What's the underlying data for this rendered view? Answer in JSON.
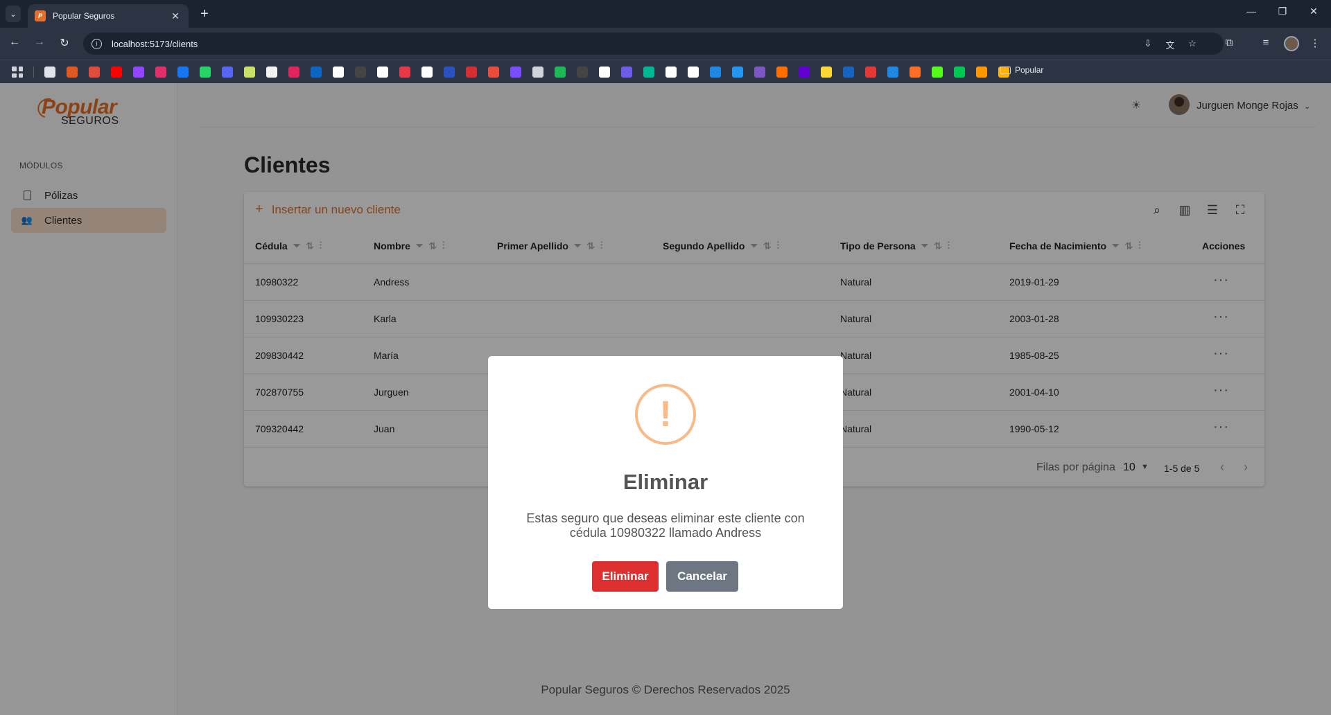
{
  "browser": {
    "tab_title": "Popular Seguros",
    "url": "localhost:5173/clients",
    "bookmark_folder": "Popular",
    "bookmark_colors": [
      "#dfe3ea",
      "#e25822",
      "#e24c3b",
      "#ff0000",
      "#9146ff",
      "#e1306c",
      "#1877f2",
      "#25d366",
      "#5865f2",
      "#c9e265",
      "#f2f2f2",
      "#e0245e",
      "#0a66c2",
      "#ffffff",
      "#444444",
      "#ffffff",
      "#e63946",
      "#ffffff",
      "#2a52be",
      "#d32f2f",
      "#e94e3a",
      "#7b4dff",
      "#cfd4dd",
      "#1db954",
      "#444444",
      "#ffffff",
      "#6c5ce7",
      "#00b894",
      "#ffffff",
      "#ffffff",
      "#1e88e5",
      "#2196f3",
      "#7e57c2",
      "#ff6f00",
      "#6001d2",
      "#fdd835",
      "#1565c0",
      "#e53935",
      "#1e88e5",
      "#fc6d26",
      "#53fc18",
      "#00c853",
      "#ff9800",
      "#ffb300"
    ]
  },
  "brand": {
    "name": "Popular",
    "sub": "SEGUROS"
  },
  "sidebar": {
    "section_title": "MÓDULOS",
    "items": [
      {
        "label": "Pólizas",
        "icon": "document-icon"
      },
      {
        "label": "Clientes",
        "icon": "users-icon",
        "active": true
      }
    ]
  },
  "header": {
    "user_name": "Jurguen Monge Rojas"
  },
  "page": {
    "title": "Clientes"
  },
  "table": {
    "insert_label": "Insertar un nuevo cliente",
    "columns": [
      "Cédula",
      "Nombre",
      "Primer Apellido",
      "Segundo Apellido",
      "Tipo de Persona",
      "Fecha de Nacimiento",
      "Acciones"
    ],
    "rows": [
      {
        "cedula": "10980322",
        "nombre": "Andress",
        "tipo": "Natural",
        "fecha": "2019-01-29"
      },
      {
        "cedula": "109930223",
        "nombre": "Karla",
        "tipo": "Natural",
        "fecha": "2003-01-28"
      },
      {
        "cedula": "209830442",
        "nombre": "María",
        "tipo": "Natural",
        "fecha": "1985-08-25"
      },
      {
        "cedula": "702870755",
        "nombre": "Jurguen",
        "tipo": "Natural",
        "fecha": "2001-04-10"
      },
      {
        "cedula": "709320442",
        "nombre": "Juan",
        "tipo": "Natural",
        "fecha": "1990-05-12"
      }
    ],
    "rows_per_page_label": "Filas por página",
    "rows_per_page_value": "10",
    "range_label": "1-5 de 5"
  },
  "footer": {
    "text": "Popular Seguros © Derechos Reservados 2025"
  },
  "modal": {
    "title": "Eliminar",
    "message": "Estas seguro que deseas eliminar este cliente con cédula 10980322 llamado Andress",
    "confirm_label": "Eliminar",
    "cancel_label": "Cancelar",
    "icon": "warning-icon",
    "colors": {
      "confirm": "#dc3030",
      "cancel": "#6e7681",
      "warning": "#f8bb86"
    }
  },
  "colors": {
    "accent": "#e86f22",
    "active_nav_bg": "#f8dcc8"
  }
}
